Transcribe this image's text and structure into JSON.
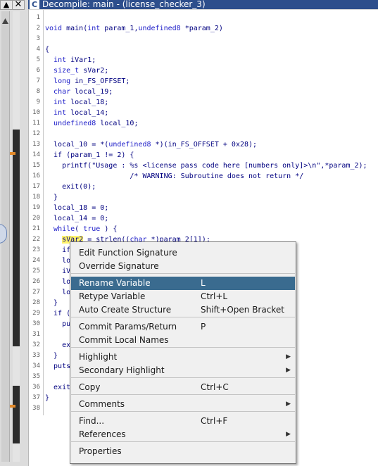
{
  "window": {
    "title": "Decompile: main -  (license_checker_3)",
    "title_icon": "C",
    "close_glyph": "✕",
    "scroll_up_glyph": "▲"
  },
  "code": {
    "lines": [
      {
        "n": "1",
        "t": ""
      },
      {
        "n": "2",
        "t": "void main(int param_1,undefined8 *param_2)"
      },
      {
        "n": "3",
        "t": ""
      },
      {
        "n": "4",
        "t": "{"
      },
      {
        "n": "5",
        "t": "  int iVar1;"
      },
      {
        "n": "6",
        "t": "  size_t sVar2;"
      },
      {
        "n": "7",
        "t": "  long in_FS_OFFSET;"
      },
      {
        "n": "8",
        "t": "  char local_19;"
      },
      {
        "n": "9",
        "t": "  int local_18;"
      },
      {
        "n": "10",
        "t": "  int local_14;"
      },
      {
        "n": "11",
        "t": "  undefined8 local_10;"
      },
      {
        "n": "12",
        "t": ""
      },
      {
        "n": "13",
        "t": "  local_10 = *(undefined8 *)(in_FS_OFFSET + 0x28);"
      },
      {
        "n": "14",
        "t": "  if (param_1 != 2) {"
      },
      {
        "n": "15",
        "t": "    printf(\"Usage : %s <license pass code here [numbers only]>\\n\",*param_2);"
      },
      {
        "n": "16",
        "t": "                    /* WARNING: Subroutine does not return */"
      },
      {
        "n": "17",
        "t": "    exit(0);"
      },
      {
        "n": "18",
        "t": "  }"
      },
      {
        "n": "19",
        "t": "  local_18 = 0;"
      },
      {
        "n": "20",
        "t": "  local_14 = 0;"
      },
      {
        "n": "21",
        "t": "  while( true ) {"
      },
      {
        "n": "22",
        "t": "    sVar2 = strlen((char *)param_2[1]);"
      },
      {
        "n": "23",
        "t": "    if"
      },
      {
        "n": "24",
        "t": "    lo"
      },
      {
        "n": "25",
        "t": "    iV"
      },
      {
        "n": "26",
        "t": "    lo"
      },
      {
        "n": "27",
        "t": "    lo"
      },
      {
        "n": "28",
        "t": "  }"
      },
      {
        "n": "29",
        "t": "  if ("
      },
      {
        "n": "30",
        "t": "    pu"
      },
      {
        "n": "31",
        "t": "                                                  */"
      },
      {
        "n": "32",
        "t": "    ex"
      },
      {
        "n": "33",
        "t": "  }"
      },
      {
        "n": "34",
        "t": "  puts"
      },
      {
        "n": "35",
        "t": "                                                  */"
      },
      {
        "n": "36",
        "t": "  exit"
      },
      {
        "n": "37",
        "t": "}"
      },
      {
        "n": "38",
        "t": ""
      }
    ]
  },
  "context_menu": {
    "items": [
      {
        "label": "Edit Function Signature",
        "accel": "",
        "submenu": false,
        "highlighted": false
      },
      {
        "label": "Override Signature",
        "accel": "",
        "submenu": false,
        "highlighted": false
      },
      {
        "label": "Rename Variable",
        "accel": "L",
        "submenu": false,
        "highlighted": true
      },
      {
        "label": "Retype Variable",
        "accel": "Ctrl+L",
        "submenu": false,
        "highlighted": false
      },
      {
        "label": "Auto Create Structure",
        "accel": "Shift+Open Bracket",
        "submenu": false,
        "highlighted": false
      },
      {
        "label": "Commit Params/Return",
        "accel": "P",
        "submenu": false,
        "highlighted": false
      },
      {
        "label": "Commit Local Names",
        "accel": "",
        "submenu": false,
        "highlighted": false
      },
      {
        "label": "Highlight",
        "accel": "",
        "submenu": true,
        "highlighted": false
      },
      {
        "label": "Secondary Highlight",
        "accel": "",
        "submenu": true,
        "highlighted": false
      },
      {
        "label": "Copy",
        "accel": "Ctrl+C",
        "submenu": false,
        "highlighted": false
      },
      {
        "label": "Comments",
        "accel": "",
        "submenu": true,
        "highlighted": false
      },
      {
        "label": "Find...",
        "accel": "Ctrl+F",
        "submenu": false,
        "highlighted": false
      },
      {
        "label": "References",
        "accel": "",
        "submenu": true,
        "highlighted": false
      },
      {
        "label": "Properties",
        "accel": "",
        "submenu": false,
        "highlighted": false
      }
    ],
    "submenu_glyph": "▶"
  },
  "colors": {
    "title_bar": "#2d4e8c",
    "menu_highlight": "#3a6b8f",
    "keyword": "#1b1bc8",
    "code_text": "#000080",
    "token_highlight": "#fff36b"
  }
}
